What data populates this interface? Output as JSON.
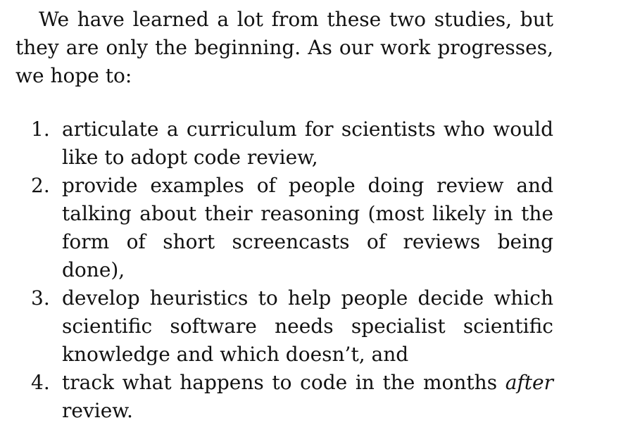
{
  "intro": "We have learned a lot from these two studies, but they are only the beginning. As our work progresses, we hope to:",
  "items": [
    {
      "number": "1.",
      "text": "articulate a curriculum for scientists who would like to adopt code review,"
    },
    {
      "number": "2.",
      "text": "provide examples of people doing review and talking about their reasoning (most likely in the form of short screencasts of reviews being done),"
    },
    {
      "number": "3.",
      "text": "develop heuristics to help people decide which scientific software needs specialist scientific knowledge and which doesn’t, and"
    },
    {
      "number": "4.",
      "text_before": "track what happens to code in the months ",
      "emph": "after",
      "text_after": " review."
    }
  ]
}
